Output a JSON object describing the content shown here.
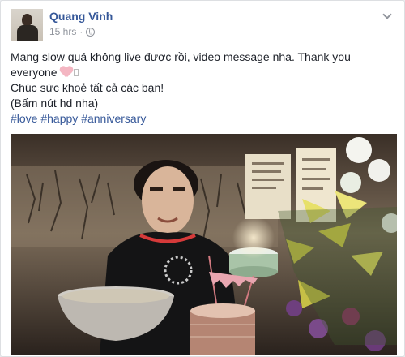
{
  "author": {
    "name": "Quang Vinh"
  },
  "post": {
    "time": "15 hrs",
    "separator": "·",
    "line1_part1": "Mạng slow quá không live được rồi, video message nha. Thank you",
    "line1_part2": "everyone",
    "line2": "Chúc sức khoẻ tất cả các bạn!",
    "line3": "(Bấm nút hd nha)",
    "hashtags": [
      "#love",
      "#happy",
      "#anniversary"
    ]
  },
  "icons": {
    "privacy": "globe-icon",
    "options": "chevron-down-icon",
    "emoji": "heart-icon"
  },
  "colors": {
    "link": "#365899",
    "text": "#1d2129",
    "meta": "#90949c"
  }
}
